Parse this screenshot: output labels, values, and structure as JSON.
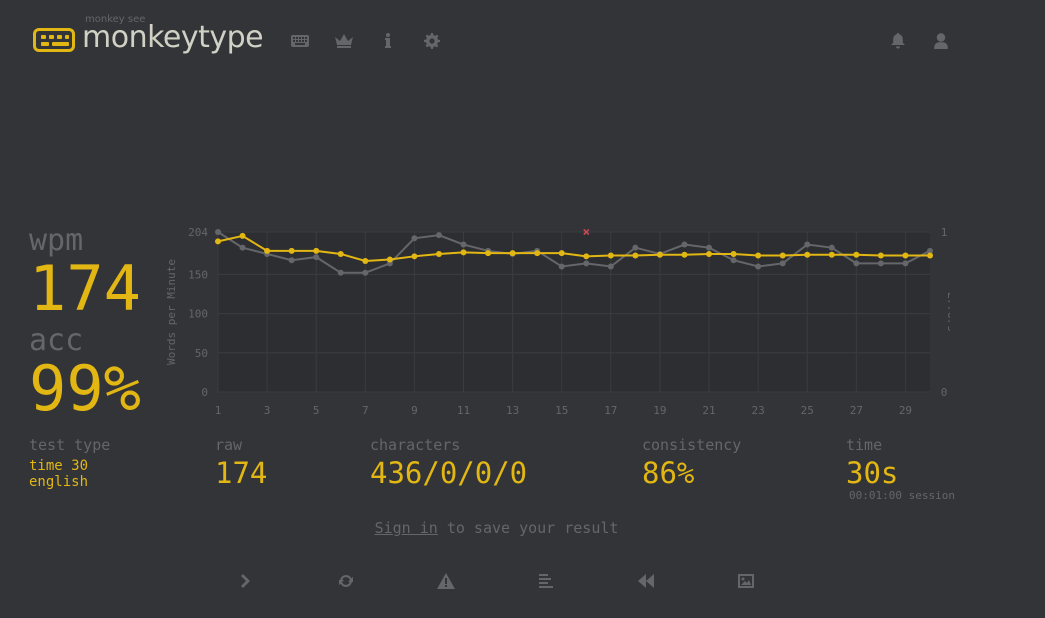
{
  "header": {
    "logo_top": "monkey see",
    "logo_text": "monkeytype",
    "nav_icons": [
      "keyboard-icon",
      "crown-icon",
      "info-icon",
      "settings-icon"
    ],
    "right_icons": [
      "bell-icon",
      "user-icon"
    ]
  },
  "stats": {
    "wpm_label": "wpm",
    "wpm_value": "174",
    "acc_label": "acc",
    "acc_value": "99%"
  },
  "details": {
    "test_type_label": "test type",
    "test_type_value_1": "time 30",
    "test_type_value_2": "english",
    "raw_label": "raw",
    "raw_value": "174",
    "characters_label": "characters",
    "characters_value": "436/0/0/0",
    "consistency_label": "consistency",
    "consistency_value": "86%",
    "time_label": "time",
    "time_value": "30s",
    "session_text": "00:01:00 session"
  },
  "footer": {
    "signin_link": "Sign in",
    "signin_rest": " to save your result",
    "buttons": [
      "next-test-icon",
      "restart-icon",
      "warning-icon",
      "words-history-icon",
      "replay-icon",
      "screenshot-icon"
    ]
  },
  "colors": {
    "background": "#323437",
    "main": "#e2b714",
    "sub": "#646669",
    "text": "#d1d0c5",
    "error": "#ca4754",
    "chart_bg": "#2c2e31"
  },
  "chart_data": {
    "type": "line",
    "x": [
      1,
      2,
      3,
      4,
      5,
      6,
      7,
      8,
      9,
      10,
      11,
      12,
      13,
      14,
      15,
      16,
      17,
      18,
      19,
      20,
      21,
      22,
      23,
      24,
      25,
      26,
      27,
      28,
      29,
      30
    ],
    "x_ticks": [
      "1",
      "3",
      "5",
      "7",
      "9",
      "11",
      "13",
      "15",
      "17",
      "19",
      "21",
      "23",
      "25",
      "27",
      "29"
    ],
    "y_ticks": [
      "0",
      "50",
      "100",
      "150",
      "204"
    ],
    "ylim": [
      0,
      204
    ],
    "ylabel": "Words per Minute",
    "y2label": "Errors",
    "y2_ticks": [
      "0",
      "1"
    ],
    "series": [
      {
        "values": [
          204,
          184,
          176,
          168,
          172,
          152,
          152,
          164,
          196,
          200,
          188,
          180,
          176,
          180,
          160,
          164,
          160,
          184,
          176,
          188,
          184,
          168,
          160,
          164,
          188,
          184,
          164,
          164,
          164,
          180
        ],
        "color": "#646669"
      },
      {
        "values": [
          192,
          199,
          180,
          180,
          180,
          176,
          167,
          169,
          173,
          176,
          178,
          177,
          177,
          177,
          177,
          173,
          174,
          174,
          175,
          175,
          176,
          176,
          174,
          174,
          175,
          175,
          175,
          174,
          174,
          174
        ],
        "color": "#e2b714"
      }
    ],
    "errors": [
      {
        "x": 16,
        "y": 1
      }
    ]
  }
}
